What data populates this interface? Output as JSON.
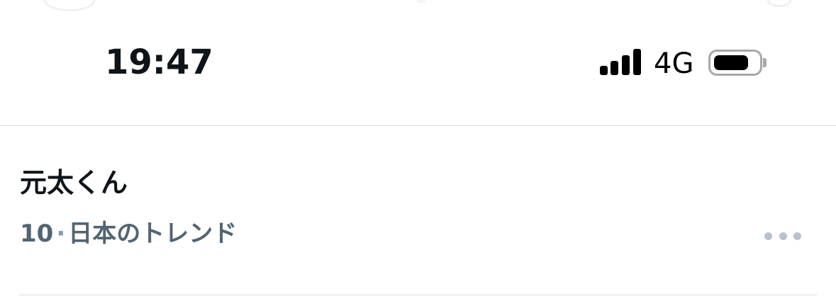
{
  "status_bar": {
    "time": "19:47",
    "network": "4G",
    "signal_icon": "cellular-signal-icon",
    "signal_bars": 4,
    "battery_icon": "battery-icon",
    "battery_level": 0.75
  },
  "trend": {
    "title": "元太くん",
    "rank": "10",
    "separator": "·",
    "category": "日本のトレンド",
    "more_icon": "more-horizontal-icon"
  },
  "colors": {
    "primary_text": "#0f1419",
    "secondary_text": "#536471",
    "divider": "#dcdcdc",
    "more_dots": "#b8c2cc"
  }
}
